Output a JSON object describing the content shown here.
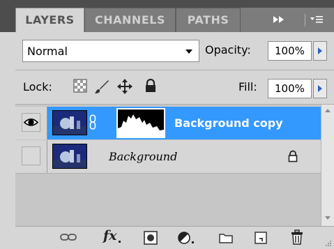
{
  "tabs": [
    {
      "label": "LAYERS",
      "active": true
    },
    {
      "label": "CHANNELS",
      "active": false
    },
    {
      "label": "PATHS",
      "active": false
    }
  ],
  "blend": {
    "mode": "Normal",
    "opacity_label": "Opacity:",
    "opacity_value": "100%"
  },
  "lock": {
    "label": "Lock:",
    "fill_label": "Fill:",
    "fill_value": "100%"
  },
  "layers": [
    {
      "name": "Background copy",
      "visible": true,
      "selected": true,
      "has_mask": true,
      "locked": false
    },
    {
      "name": "Background",
      "visible": false,
      "selected": false,
      "has_mask": false,
      "locked": true
    }
  ],
  "colors": {
    "selection": "#3399ff",
    "panel": "#d6d6d6",
    "tab_bar": "#4d4d4d"
  },
  "icons": {
    "tab_controls": [
      "fast-forward-icon",
      "panel-menu-icon"
    ],
    "lock": [
      "lock-transparent-icon",
      "lock-pixels-icon",
      "lock-position-icon",
      "lock-all-icon"
    ],
    "bottom": [
      "link-layers-icon",
      "fx-icon",
      "add-mask-icon",
      "adjustment-layer-icon",
      "new-group-icon",
      "new-layer-icon",
      "trash-icon"
    ]
  }
}
